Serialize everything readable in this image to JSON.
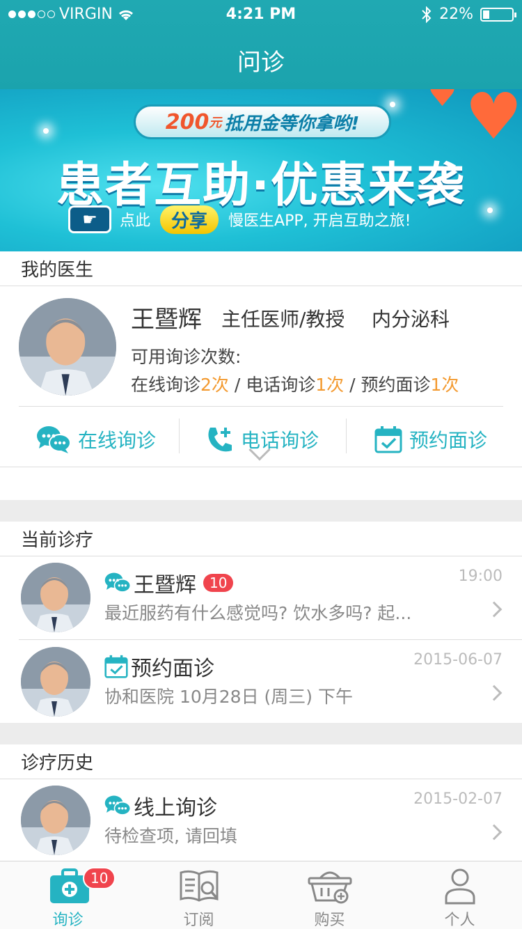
{
  "status_bar": {
    "carrier": "VIRGIN",
    "time": "4:21 PM",
    "battery": "22%"
  },
  "nav": {
    "title": "问诊"
  },
  "banner": {
    "pill_amount": "200",
    "pill_unit": "元",
    "pill_text": "抵用金等你拿哟!",
    "headline": "患者互助·优惠来袭",
    "tap_text": "点此",
    "share_button": "分享",
    "share_tail": "慢医生APP, 开启互助之旅!"
  },
  "my_doctor": {
    "header": "我的医生",
    "name": "王暨辉",
    "title": "主任医师/教授",
    "dept": "内分泌科",
    "avail_label": "可用询诊次数:",
    "online_label": "在线询诊",
    "online_count": "2次",
    "sep1": " / ",
    "phone_label": "电话询诊",
    "phone_count": "1次",
    "sep2": " / ",
    "appt_label": "预约面诊",
    "appt_count": "1次",
    "actions": [
      {
        "label": "在线询诊",
        "icon": "chat-icon"
      },
      {
        "label": "电话询诊",
        "icon": "phone-plus-icon"
      },
      {
        "label": "预约面诊",
        "icon": "calendar-check-icon"
      }
    ]
  },
  "current": {
    "header": "当前诊疗",
    "items": [
      {
        "title": "王暨辉",
        "badge": "10",
        "sub": "最近服药有什么感觉吗? 饮水多吗? 起...",
        "time": "19:00",
        "icon": "chat-icon"
      },
      {
        "title": "预约面诊",
        "sub": "协和医院  10月28日 (周三) 下午",
        "time": "2015-06-07",
        "icon": "calendar-check-icon"
      }
    ]
  },
  "history": {
    "header": "诊疗历史",
    "items": [
      {
        "title": "线上询诊",
        "sub": "待检查项, 请回填",
        "time": "2015-02-07",
        "icon": "chat-icon"
      }
    ]
  },
  "tabbar": {
    "tabs": [
      {
        "label": "询诊",
        "icon": "medical-kit-icon",
        "badge": "10"
      },
      {
        "label": "订阅",
        "icon": "book-search-icon"
      },
      {
        "label": "购买",
        "icon": "basket-icon"
      },
      {
        "label": "个人",
        "icon": "person-icon"
      }
    ]
  },
  "colors": {
    "teal": "#25b3c2",
    "accent": "#f39a30",
    "badge": "#f0444d"
  }
}
